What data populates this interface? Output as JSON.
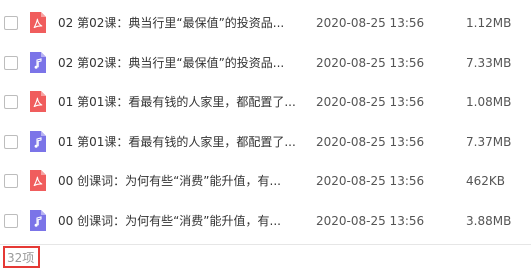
{
  "colors": {
    "pdf_icon": "#f05d5d",
    "audio_icon": "#7b74e8",
    "highlight_border": "#e53935"
  },
  "files": [
    {
      "name": "02 第02课：典当行里“最保值”的投资品...",
      "date": "2020-08-25 13:56",
      "size": "1.12MB",
      "icon": "pdf-icon"
    },
    {
      "name": "02 第02课：典当行里“最保值”的投资品...",
      "date": "2020-08-25 13:56",
      "size": "7.33MB",
      "icon": "audio-icon"
    },
    {
      "name": "01 第01课：看最有钱的人家里，都配置了...",
      "date": "2020-08-25 13:56",
      "size": "1.08MB",
      "icon": "pdf-icon"
    },
    {
      "name": "01 第01课：看最有钱的人家里，都配置了...",
      "date": "2020-08-25 13:56",
      "size": "7.37MB",
      "icon": "audio-icon"
    },
    {
      "name": "00 创课词：为何有些“消费”能升值，有...",
      "date": "2020-08-25 13:56",
      "size": "462KB",
      "icon": "pdf-icon"
    },
    {
      "name": "00 创课词：为何有些“消费”能升值，有...",
      "date": "2020-08-25 13:56",
      "size": "3.88MB",
      "icon": "audio-icon"
    }
  ],
  "footer": {
    "item_count": "32项"
  }
}
